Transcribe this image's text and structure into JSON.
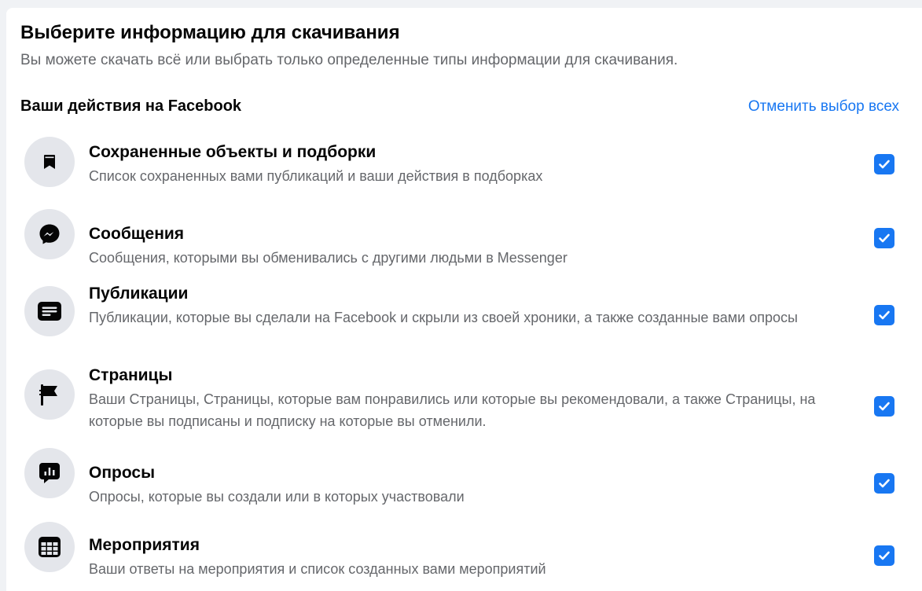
{
  "header": {
    "title": "Выберите информацию для скачивания",
    "subtitle": "Вы можете скачать всё или выбрать только определенные типы информации для скачивания."
  },
  "section": {
    "title": "Ваши действия на Facebook",
    "deselect_all": "Отменить выбор всех"
  },
  "items": [
    {
      "icon": "bookmark-icon",
      "title": "Сохраненные объекты и подборки",
      "description": "Список сохраненных вами публикаций и ваши действия в подборках",
      "checked": true
    },
    {
      "icon": "messenger-icon",
      "title": "Сообщения",
      "description": "Сообщения, которыми вы обменивались с другими людьми в Messenger",
      "checked": true
    },
    {
      "icon": "post-icon",
      "title": "Публикации",
      "description": "Публикации, которые вы сделали на Facebook и скрыли из своей хроники, а также созданные вами опросы",
      "checked": true
    },
    {
      "icon": "flag-icon",
      "title": "Страницы",
      "description": "Ваши Страницы, Страницы, которые вам понравились или которые вы рекомендовали, а также Страницы, на которые вы подписаны и подписку на которые вы отменили.",
      "checked": true
    },
    {
      "icon": "poll-icon",
      "title": "Опросы",
      "description": "Опросы, которые вы создали или в которых участвовали",
      "checked": true
    },
    {
      "icon": "calendar-icon",
      "title": "Мероприятия",
      "description": "Ваши ответы на мероприятия и список созданных вами мероприятий",
      "checked": true
    }
  ],
  "colors": {
    "accent": "#1877f2",
    "icon_background": "#e4e6eb",
    "secondary_text": "#65676b"
  }
}
